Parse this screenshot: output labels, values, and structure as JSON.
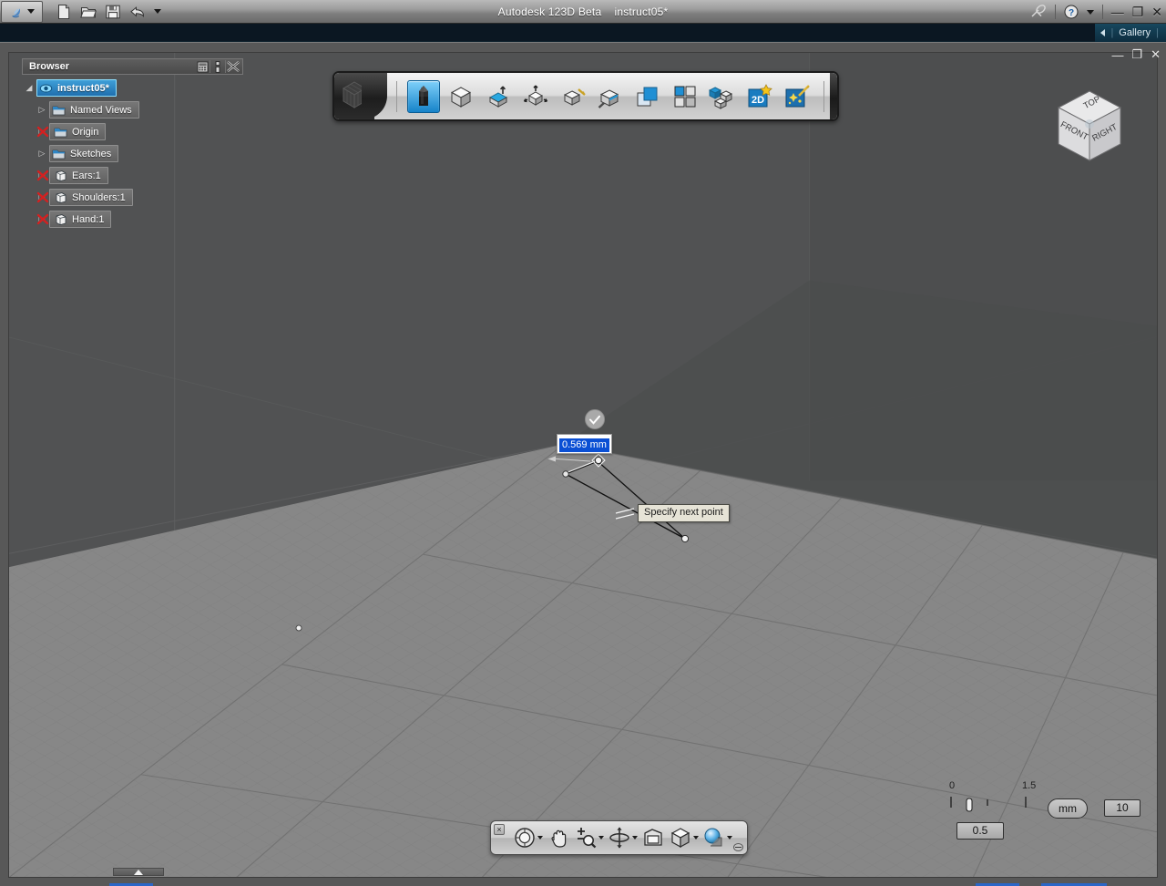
{
  "window": {
    "app_title": "Autodesk 123D Beta",
    "document_title": "instruct05*",
    "title_full": "Autodesk 123D Beta    instruct05*",
    "minimize": "—",
    "maximize": "❐",
    "close": "✕"
  },
  "quick_access": {
    "items": [
      {
        "name": "app-menu",
        "label": "123D"
      },
      {
        "name": "new-file",
        "label": "New"
      },
      {
        "name": "open-file",
        "label": "Open"
      },
      {
        "name": "save-file",
        "label": "Save"
      },
      {
        "name": "undo",
        "label": "Undo"
      },
      {
        "name": "customize-qat",
        "label": "Customize"
      }
    ]
  },
  "title_right": {
    "broadcast_label": "Broadcast",
    "help_label": "Help"
  },
  "gallery_bar": {
    "label": "Gallery",
    "collapse_arrow": "◀",
    "divider": "|"
  },
  "doc_window": {
    "minimize": "—",
    "restore": "❐",
    "close": "✕"
  },
  "browser": {
    "title": "Browser",
    "header_icons": [
      {
        "name": "filter-icon",
        "label": "Filter"
      },
      {
        "name": "dock-icon",
        "label": "Dock"
      },
      {
        "name": "close-icon",
        "label": "Close"
      }
    ],
    "items": [
      {
        "label": "instruct05*",
        "indent": 0,
        "selected": true,
        "icon": "eye-pin-icon",
        "expander": "◢",
        "hidden": false
      },
      {
        "label": "Named Views",
        "indent": 1,
        "selected": false,
        "icon": "folder-icon",
        "expander": "▷",
        "hidden": false
      },
      {
        "label": "Origin",
        "indent": 1,
        "selected": false,
        "icon": "folder-icon",
        "expander": "▷",
        "hidden": true
      },
      {
        "label": "Sketches",
        "indent": 1,
        "selected": false,
        "icon": "folder-icon",
        "expander": "▷",
        "hidden": false
      },
      {
        "label": "Ears:1",
        "indent": 1,
        "selected": false,
        "icon": "solid-icon",
        "expander": "▷",
        "hidden": true
      },
      {
        "label": "Shoulders:1",
        "indent": 1,
        "selected": false,
        "icon": "solid-icon",
        "expander": "▷",
        "hidden": true
      },
      {
        "label": "Hand:1",
        "indent": 1,
        "selected": false,
        "icon": "solid-icon",
        "expander": "▷",
        "hidden": true
      }
    ]
  },
  "toolbar": {
    "logo_name": "123d-cube-logo",
    "buttons": [
      {
        "name": "sketch-tool",
        "label": "Sketch",
        "icon": "pencil-icon",
        "active": true
      },
      {
        "name": "primitives-tool",
        "label": "Primitives",
        "icon": "cube-icon",
        "active": false
      },
      {
        "name": "construct-tool",
        "label": "Construct",
        "icon": "extrude-icon",
        "active": false
      },
      {
        "name": "modify-tool",
        "label": "Modify",
        "icon": "transform-icon",
        "active": false
      },
      {
        "name": "pattern-tool",
        "label": "Pattern",
        "icon": "cube-arrow-icon",
        "active": false
      },
      {
        "name": "combine-tool",
        "label": "Combine",
        "icon": "combine-icon",
        "active": false
      },
      {
        "name": "grid-tool",
        "label": "Grid",
        "icon": "four-squares-icon",
        "active": false
      },
      {
        "name": "assembly-tool",
        "label": "Assembly",
        "icon": "cube-stack-icon",
        "active": false
      },
      {
        "name": "twod-tool",
        "label": "2D",
        "icon": "2d-star-icon",
        "active": false,
        "text": "2D"
      },
      {
        "name": "smart-tool",
        "label": "Smart",
        "icon": "magic-wand-icon",
        "active": false
      }
    ]
  },
  "viewcube": {
    "top": "TOP",
    "front": "FRONT",
    "right": "RIGHT"
  },
  "canvas": {
    "dimension_value": "0.569 mm",
    "tooltip": "Specify next point",
    "confirm_icon": "check-circle-icon",
    "active_command": "Sketch line"
  },
  "scale_widget": {
    "tick_start_label": "0",
    "tick_end_label": "1.5",
    "slider_value": "0.5",
    "unit_label": "mm",
    "grid_value": "10"
  },
  "nav_bar": {
    "close_label": "×",
    "menu_label": "☰",
    "buttons": [
      {
        "name": "steering-wheel-button",
        "label": "SteeringWheels",
        "icon": "steering-wheel-icon",
        "caret": true
      },
      {
        "name": "pan-button",
        "label": "Pan",
        "icon": "hand-icon",
        "caret": false
      },
      {
        "name": "zoom-button",
        "label": "Zoom",
        "icon": "zoom-icon",
        "caret": true
      },
      {
        "name": "orbit-button",
        "label": "Orbit",
        "icon": "orbit-icon",
        "caret": true
      },
      {
        "name": "look-at-button",
        "label": "Look At",
        "icon": "look-at-icon",
        "caret": false
      },
      {
        "name": "view-cube-button",
        "label": "View Cube",
        "icon": "cube-view-icon",
        "caret": true
      },
      {
        "name": "display-style-button",
        "label": "Display Style",
        "icon": "sphere-icon",
        "caret": true
      }
    ]
  },
  "colors": {
    "background": "#515253",
    "ground": "#878787",
    "accent_blue": "#1f6fae",
    "selection_blue": "#0a4fd4",
    "tooltip_bg": "#e6e3d6",
    "gallery_bg": "#0b1722"
  }
}
